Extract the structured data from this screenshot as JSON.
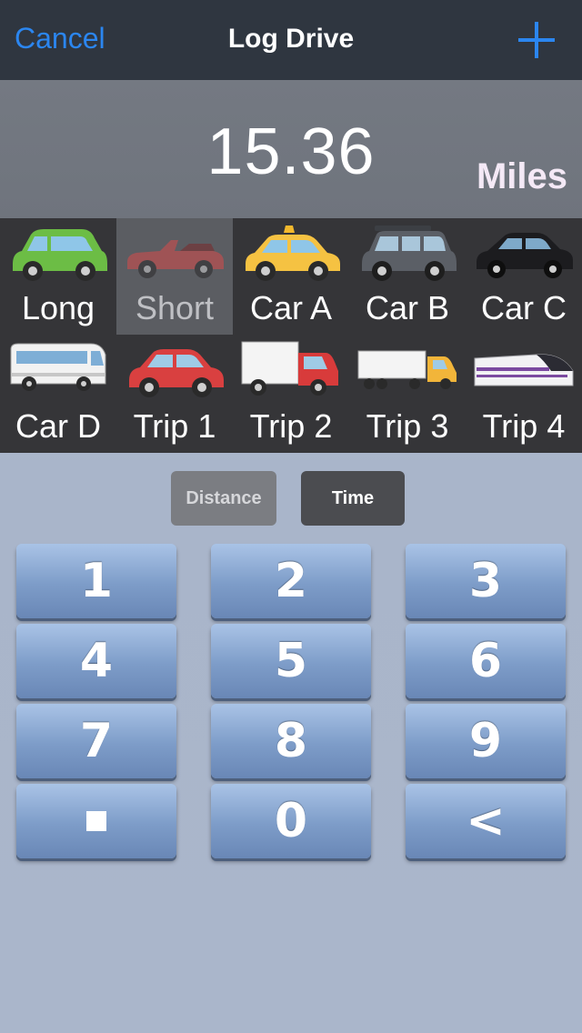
{
  "nav": {
    "cancel_label": "Cancel",
    "title": "Log Drive",
    "add_icon": "plus-icon"
  },
  "display": {
    "value": "15.36",
    "unit": "Miles"
  },
  "vehicles": [
    {
      "label": "Long",
      "icon": "green-hatchback-icon",
      "selected": false
    },
    {
      "label": "Short",
      "icon": "red-convertible-icon",
      "selected": true
    },
    {
      "label": "Car A",
      "icon": "taxi-icon",
      "selected": false
    },
    {
      "label": "Car B",
      "icon": "suv-icon",
      "selected": false
    },
    {
      "label": "Car C",
      "icon": "black-sedan-icon",
      "selected": false
    },
    {
      "label": "Car D",
      "icon": "bus-icon",
      "selected": false
    },
    {
      "label": "Trip 1",
      "icon": "red-car-icon",
      "selected": false
    },
    {
      "label": "Trip 2",
      "icon": "box-truck-icon",
      "selected": false
    },
    {
      "label": "Trip 3",
      "icon": "semi-truck-icon",
      "selected": false
    },
    {
      "label": "Trip 4",
      "icon": "bullet-train-icon",
      "selected": false
    }
  ],
  "mode": {
    "distance_label": "Distance",
    "time_label": "Time",
    "active": "Distance"
  },
  "keypad": {
    "k1": "1",
    "k2": "2",
    "k3": "3",
    "k4": "4",
    "k5": "5",
    "k6": "6",
    "k7": "7",
    "k8": "8",
    "k9": "9",
    "k0": "0",
    "back": "<"
  },
  "colors": {
    "accent": "#2b86f0",
    "navbar": "#2f3640",
    "grid_bg": "#353538",
    "key_blue": "#7d9cc8"
  }
}
